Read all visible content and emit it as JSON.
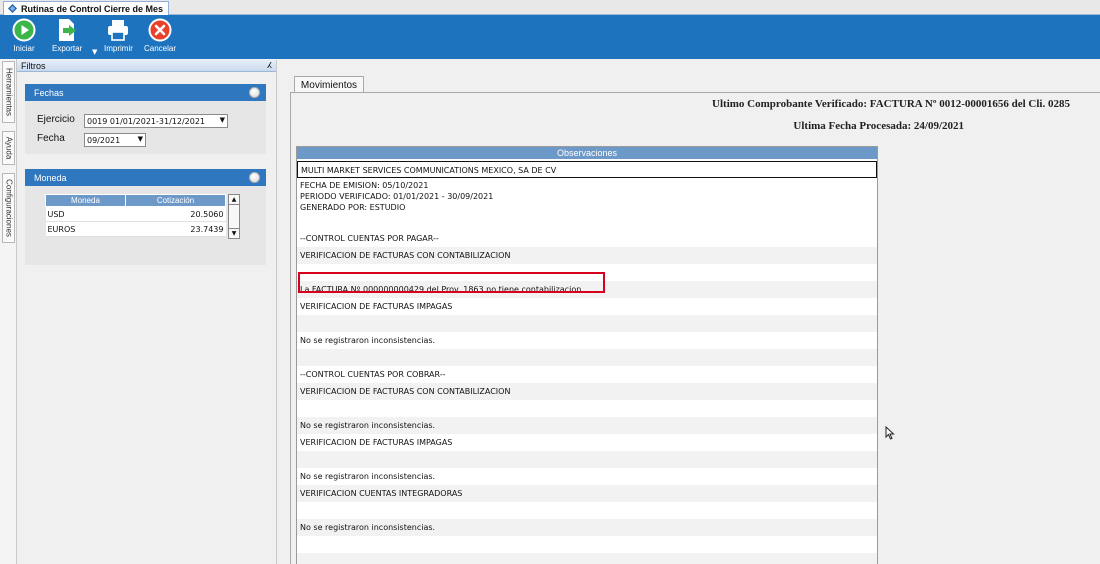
{
  "window": {
    "tab_title": "Rutinas de Control Cierre de Mes"
  },
  "toolbar": {
    "iniciar": "Iniciar",
    "exportar": "Exportar",
    "imprimir": "Imprimir",
    "cancelar": "Cancelar"
  },
  "side_tabs": [
    "Herramientas",
    "Ayuda",
    "Configuraciones"
  ],
  "filtros": {
    "title": "Filtros",
    "pin": "ⵃ",
    "fechas": {
      "title": "Fechas",
      "ejercicio_label": "Ejercicio",
      "ejercicio_value": "0019 01/01/2021-31/12/2021",
      "fecha_label": "Fecha",
      "fecha_value": "09/2021"
    },
    "moneda": {
      "title": "Moneda",
      "columns": [
        "Moneda",
        "Cotización"
      ],
      "rows": [
        {
          "moneda": "USD",
          "cotizacion": "20.5060"
        },
        {
          "moneda": "EUROS",
          "cotizacion": "23.7439"
        }
      ]
    }
  },
  "main": {
    "tab_label": "Movimientos",
    "ultimo_comprobante": "Ultimo Comprobante Verificado: FACTURA Nº 0012-00001656 del Cli. 0285",
    "ultima_fecha": "Ultima Fecha Procesada: 24/09/2021",
    "observaciones_header": "Observaciones",
    "rows": [
      "MULTI MARKET SERVICES COMMUNICATIONS MEXICO, SA DE CV",
      "FECHA DE EMISION: 05/10/2021",
      "PERIODO VERIFICADO: 01/01/2021 - 30/09/2021",
      "GENERADO POR: ESTUDIO",
      "--CONTROL CUENTAS POR PAGAR--",
      "VERIFICACION DE FACTURAS CON CONTABILIZACION",
      "",
      "La FACTURA    Nº 000000000429 del Prov. 1863 no tiene contabilizacion.",
      "VERIFICACION DE FACTURAS IMPAGAS",
      "",
      "No se registraron inconsistencias.",
      "",
      "--CONTROL CUENTAS POR COBRAR--",
      "VERIFICACION DE FACTURAS CON CONTABILIZACION",
      "",
      "No se registraron inconsistencias.",
      "VERIFICACION DE FACTURAS IMPAGAS",
      "",
      "No se registraron inconsistencias.",
      "VERIFICACION CUENTAS INTEGRADORAS",
      "",
      "No se registraron inconsistencias.",
      "",
      ""
    ]
  },
  "colors": {
    "toolbar_bg": "#1e73be",
    "group_header": "#2f78c0",
    "table_header": "#6d99c8",
    "highlight_border": "#d8001c"
  }
}
